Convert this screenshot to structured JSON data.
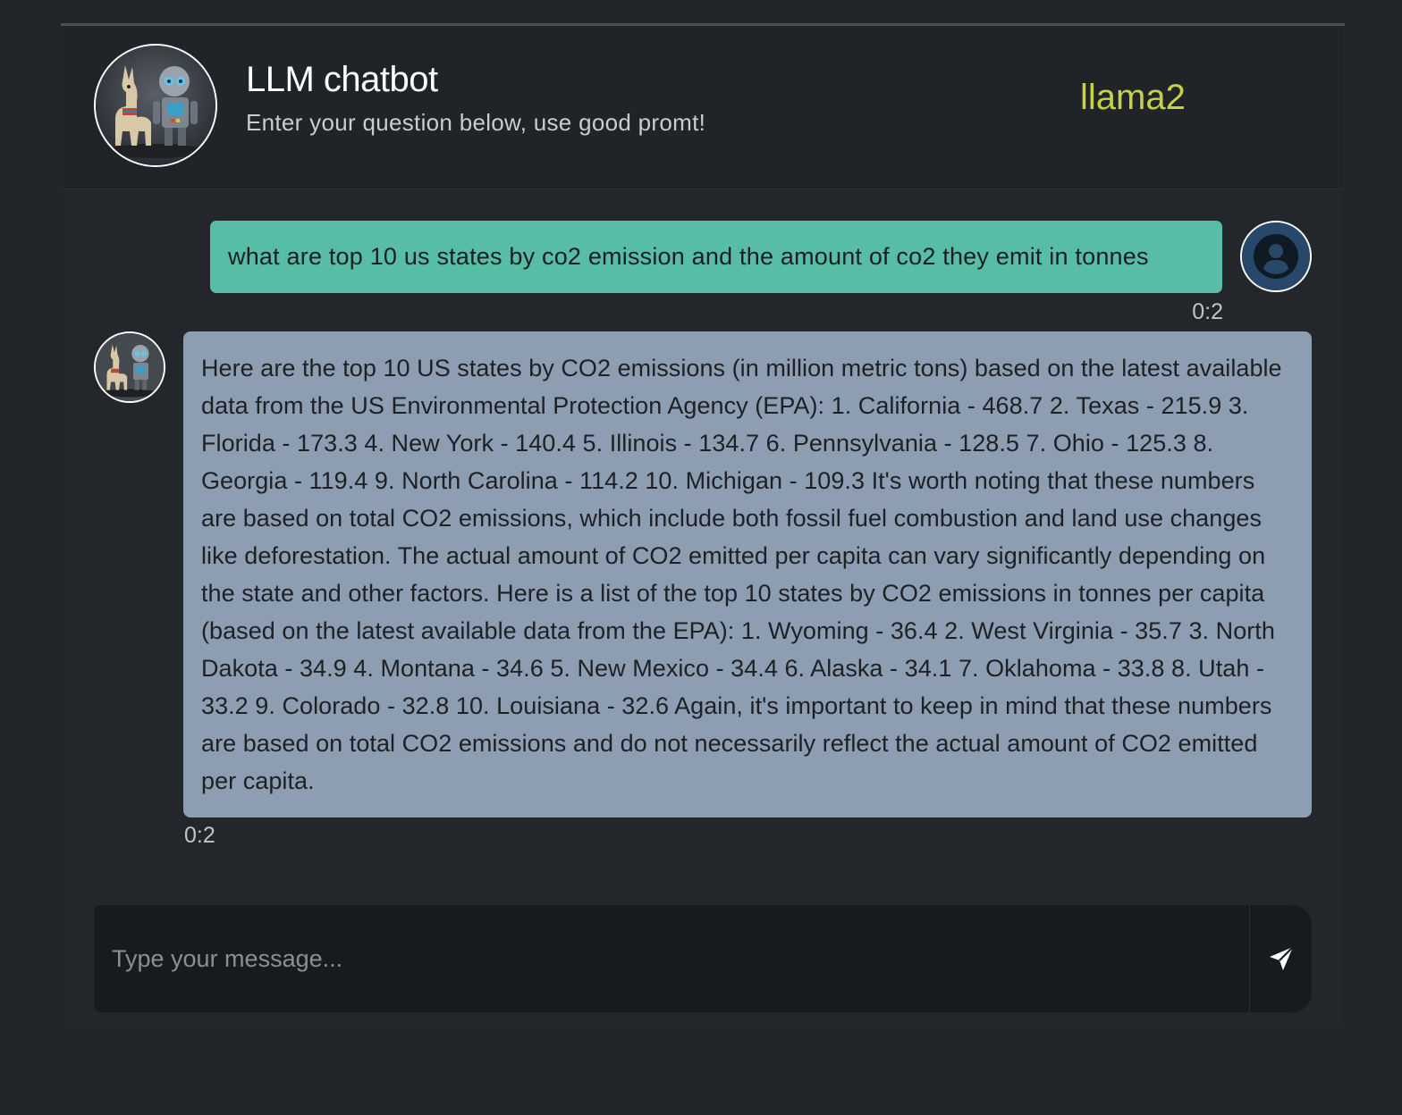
{
  "header": {
    "title": "LLM chatbot",
    "subtitle": "Enter your question below, use good promt!",
    "model": "llama2",
    "model_color": "#c5d146"
  },
  "messages": [
    {
      "role": "user",
      "text": "what are top 10 us states by co2 emission and the amount of co2 they emit in tonnes",
      "time": "0:2",
      "bubble_color": "#58bda7",
      "avatar_icon": "user-circle-icon"
    },
    {
      "role": "bot",
      "text": "Here are the top 10 US states by CO2 emissions (in million metric tons) based on the latest available data from the US Environmental Protection Agency (EPA): 1. California - 468.7 2. Texas - 215.9 3. Florida - 173.3 4. New York - 140.4 5. Illinois - 134.7 6. Pennsylvania - 128.5 7. Ohio - 125.3 8. Georgia - 119.4 9. North Carolina - 114.2 10. Michigan - 109.3 It's worth noting that these numbers are based on total CO2 emissions, which include both fossil fuel combustion and land use changes like deforestation. The actual amount of CO2 emitted per capita can vary significantly depending on the state and other factors. Here is a list of the top 10 states by CO2 emissions in tonnes per capita (based on the latest available data from the EPA): 1. Wyoming - 36.4 2. West Virginia - 35.7 3. North Dakota - 34.9 4. Montana - 34.6 5. New Mexico - 34.4 6. Alaska - 34.1 7. Oklahoma - 33.8 8. Utah - 33.2 9. Colorado - 32.8 10. Louisiana - 32.6 Again, it's important to keep in mind that these numbers are based on total CO2 emissions and do not necessarily reflect the actual amount of CO2 emitted per capita.",
      "time": "0:2",
      "bubble_color": "#8d9db2",
      "avatar_icon": "llama-robot-avatar"
    }
  ],
  "composer": {
    "placeholder": "Type your message...",
    "value": "",
    "send_icon": "send-paper-plane-icon"
  }
}
